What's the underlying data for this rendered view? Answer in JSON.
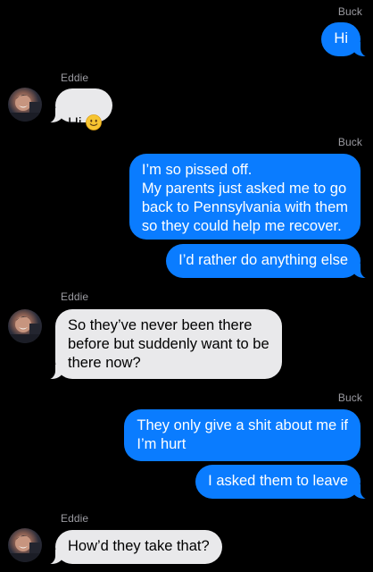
{
  "colors": {
    "background": "#000000",
    "outgoing_bubble": "#0a7cff",
    "incoming_bubble": "#e9e9eb",
    "sender_label": "#9b9ba1"
  },
  "messages": [
    {
      "sender": "Buck",
      "text": "Hi"
    },
    {
      "sender": "Eddie",
      "text": "Hi",
      "emoji": "slightly-smiling-face-icon"
    },
    {
      "sender": "Buck",
      "text": "I’m so pissed off.\nMy parents just asked me to go\nback to Pennsylvania with them\nso they could help me recover."
    },
    {
      "sender": "",
      "text": "I’d rather do anything else"
    },
    {
      "sender": "Eddie",
      "text": "So they’ve never been there\nbefore but suddenly want to be\nthere now?"
    },
    {
      "sender": "Buck",
      "text": "They only give a shit about me if\nI’m hurt"
    },
    {
      "sender": "",
      "text": "I asked them to leave"
    },
    {
      "sender": "Eddie",
      "text": "How’d they take that?"
    }
  ]
}
